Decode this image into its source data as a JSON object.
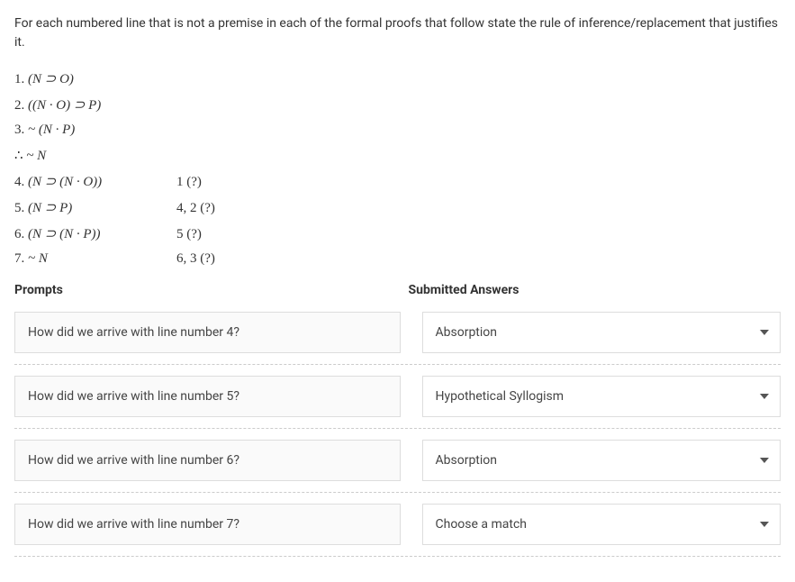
{
  "question": "For each numbered line that is not a premise in each of the formal proofs that follow state the rule of inference/replacement that justifies it.",
  "proof": {
    "lines": [
      {
        "n": "1.",
        "formula": "(N  ⊃  O)",
        "just": ""
      },
      {
        "n": "2.",
        "formula": "((N · O)  ⊃  P)",
        "just": ""
      },
      {
        "n": "3.",
        "formula": "~ (N · P)",
        "just": ""
      },
      {
        "n": "∴",
        "formula": "~ N",
        "just": ""
      },
      {
        "n": "4.",
        "formula": "(N  ⊃  (N · O))",
        "just": "1 (?)"
      },
      {
        "n": "5.",
        "formula": "(N  ⊃  P)",
        "just": "4, 2 (?)"
      },
      {
        "n": "6.",
        "formula": "(N  ⊃  (N · P))",
        "just": "5 (?)"
      },
      {
        "n": "7.",
        "formula": "~ N",
        "just": "6, 3 (?)"
      }
    ]
  },
  "headers": {
    "prompts": "Prompts",
    "answers": "Submitted Answers"
  },
  "rows": [
    {
      "prompt": "How did we arrive with line number 4?",
      "answer": "Absorption"
    },
    {
      "prompt": "How did we arrive with line number 5?",
      "answer": "Hypothetical Syllogism"
    },
    {
      "prompt": "How did we arrive with line number 6?",
      "answer": "Absorption"
    },
    {
      "prompt": "How did we arrive with line number 7?",
      "answer": "Choose a match"
    }
  ]
}
